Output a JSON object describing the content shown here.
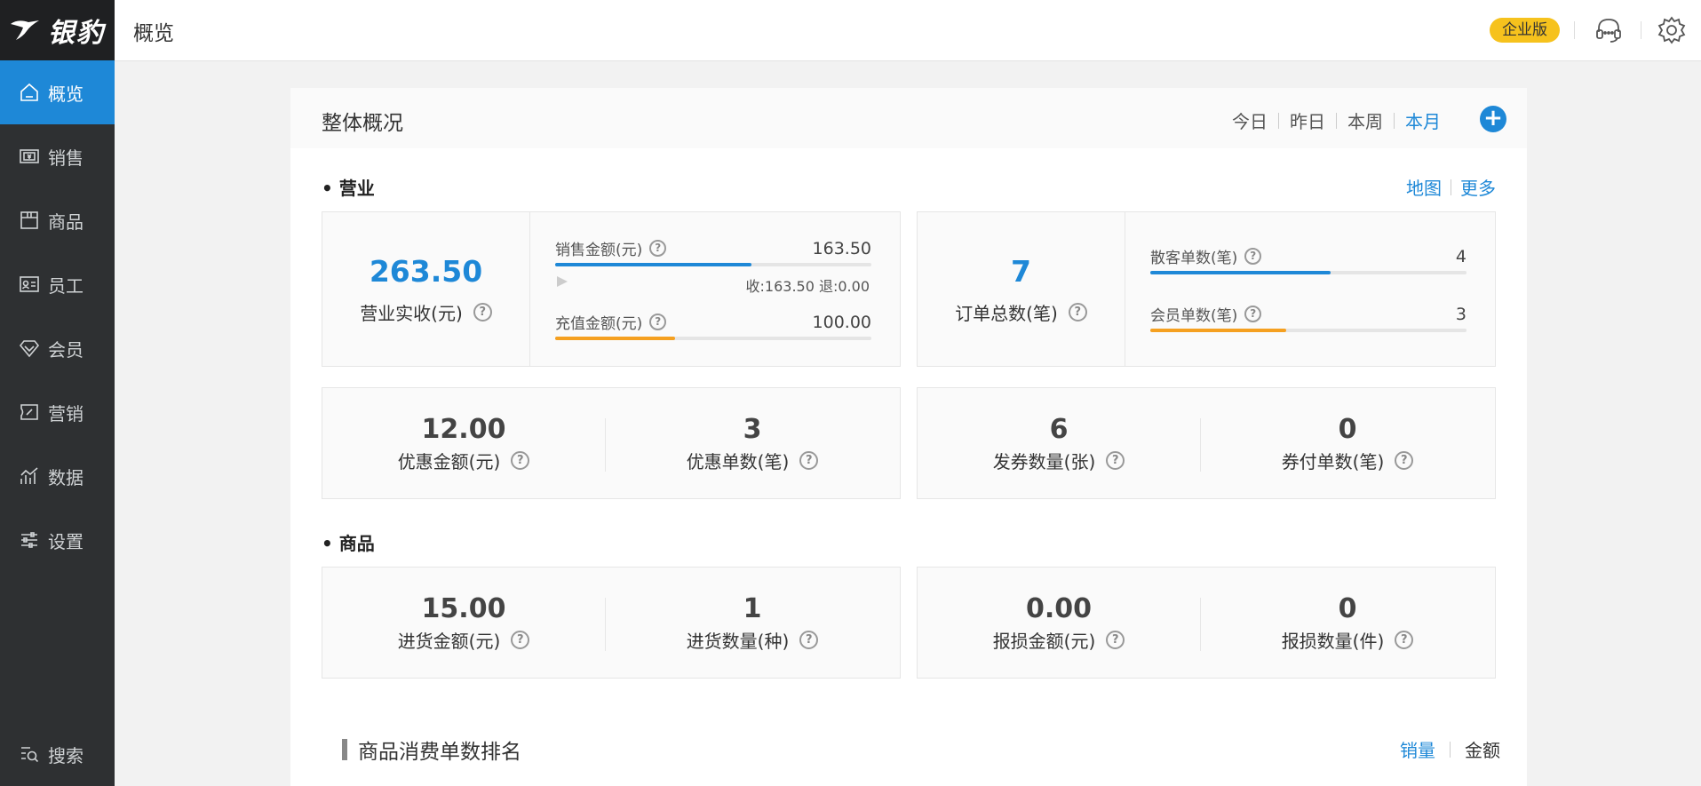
{
  "app": {
    "logo_text": "银豹"
  },
  "sidebar": {
    "items": [
      {
        "label": "概览",
        "icon": "home-icon"
      },
      {
        "label": "销售",
        "icon": "cash-icon"
      },
      {
        "label": "商品",
        "icon": "box-icon"
      },
      {
        "label": "员工",
        "icon": "id-card-icon"
      },
      {
        "label": "会员",
        "icon": "diamond-icon"
      },
      {
        "label": "营销",
        "icon": "coupon-icon"
      },
      {
        "label": "数据",
        "icon": "chart-icon"
      },
      {
        "label": "设置",
        "icon": "sliders-icon"
      }
    ],
    "bottom": {
      "label": "搜索",
      "icon": "search-icon"
    }
  },
  "topbar": {
    "title": "概览",
    "edition_badge": "企业版"
  },
  "overview": {
    "title": "整体概况",
    "periods": [
      "今日",
      "昨日",
      "本周",
      "本月"
    ],
    "active_period": "本月"
  },
  "business": {
    "title": "• 营业",
    "links": [
      "地图",
      "更多"
    ],
    "revenue": {
      "value": "263.50",
      "label": "营业实收(元)",
      "sales": {
        "label": "销售金额(元)",
        "value": "163.50",
        "progress": 0.62,
        "detail": "收:163.50 退:0.00"
      },
      "recharge": {
        "label": "充值金额(元)",
        "value": "100.00",
        "progress": 0.38
      }
    },
    "orders": {
      "value": "7",
      "label": "订单总数(笔)",
      "walkin": {
        "label": "散客单数(笔)",
        "value": "4",
        "progress": 0.57
      },
      "member": {
        "label": "会员单数(笔)",
        "value": "3",
        "progress": 0.43
      }
    },
    "discount": [
      {
        "value": "12.00",
        "label": "优惠金额(元)"
      },
      {
        "value": "3",
        "label": "优惠单数(笔)"
      }
    ],
    "coupon": [
      {
        "value": "6",
        "label": "发券数量(张)"
      },
      {
        "value": "0",
        "label": "券付单数(笔)"
      }
    ]
  },
  "goods": {
    "title": "• 商品",
    "purchase": [
      {
        "value": "15.00",
        "label": "进货金额(元)"
      },
      {
        "value": "1",
        "label": "进货数量(种)"
      }
    ],
    "loss": [
      {
        "value": "0.00",
        "label": "报损金额(元)"
      },
      {
        "value": "0",
        "label": "报损数量(件)"
      }
    ]
  },
  "ranking": {
    "title": "商品消费单数排名",
    "tabs": [
      "销量",
      "金额"
    ],
    "active_tab": "销量"
  },
  "colors": {
    "accent": "#1e88d7",
    "orange": "#f5a020",
    "sidebar": "#2e3032",
    "badge": "#f6c21d"
  }
}
